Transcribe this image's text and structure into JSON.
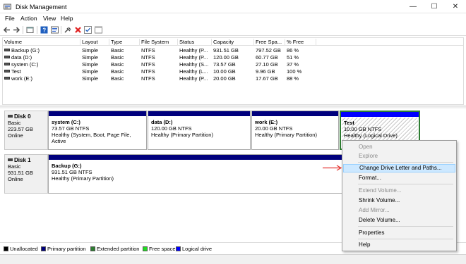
{
  "window": {
    "title": "Disk Management",
    "minimize": "—",
    "maximize": "☐",
    "close": "✕"
  },
  "menu": [
    "File",
    "Action",
    "View",
    "Help"
  ],
  "toolbar_icons": [
    "back-arrow-icon",
    "forward-arrow-icon",
    "properties-icon",
    "help-icon",
    "console-icon",
    "connect-icon",
    "delete-icon",
    "check-icon",
    "window-icon"
  ],
  "volume_list": {
    "columns": [
      "Volume",
      "Layout",
      "Type",
      "File System",
      "Status",
      "Capacity",
      "Free Spa...",
      "% Free"
    ],
    "rows": [
      [
        "Backup (G:)",
        "Simple",
        "Basic",
        "NTFS",
        "Healthy (P...",
        "931.51 GB",
        "797.52 GB",
        "86 %"
      ],
      [
        "data (D:)",
        "Simple",
        "Basic",
        "NTFS",
        "Healthy (P...",
        "120.00 GB",
        "60.77 GB",
        "51 %"
      ],
      [
        "system (C:)",
        "Simple",
        "Basic",
        "NTFS",
        "Healthy (S...",
        "73.57 GB",
        "27.10 GB",
        "37 %"
      ],
      [
        "Test",
        "Simple",
        "Basic",
        "NTFS",
        "Healthy (L...",
        "10.00 GB",
        "9.96 GB",
        "100 %"
      ],
      [
        "work (E:)",
        "Simple",
        "Basic",
        "NTFS",
        "Healthy (P...",
        "20.00 GB",
        "17.67 GB",
        "88 %"
      ]
    ]
  },
  "disks": [
    {
      "name": "Disk 0",
      "type": "Basic",
      "size": "223.57 GB",
      "status": "Online",
      "partitions": [
        {
          "name": "system  (C:)",
          "size": "73.57 GB NTFS",
          "health": "Healthy (System, Boot, Page File, Active"
        },
        {
          "name": "data  (D:)",
          "size": "120.00 GB NTFS",
          "health": "Healthy (Primary Partition)"
        },
        {
          "name": "work  (E:)",
          "size": "20.00 GB NTFS",
          "health": "Healthy (Primary Partition)"
        },
        {
          "name": "Test",
          "size": "10.00 GB NTFS",
          "health": "Healthy (Logical Drive)"
        }
      ]
    },
    {
      "name": "Disk 1",
      "type": "Basic",
      "size": "931.51 GB",
      "status": "Online",
      "partitions": [
        {
          "name": "Backup  (G:)",
          "size": "931.51 GB NTFS",
          "health": "Healthy (Primary Partition)"
        }
      ]
    }
  ],
  "legend": [
    {
      "label": "Unallocated",
      "color": "#000000"
    },
    {
      "label": "Primary partition",
      "color": "#00007d"
    },
    {
      "label": "Extended partition",
      "color": "#2e7d32"
    },
    {
      "label": "Free space",
      "color": "#22dd22"
    },
    {
      "label": "Logical drive",
      "color": "#0000ff"
    }
  ],
  "context_menu": {
    "items": [
      {
        "label": "Open",
        "enabled": false
      },
      {
        "label": "Explore",
        "enabled": false
      },
      {
        "label": "Change Drive Letter and Paths...",
        "enabled": true,
        "highlighted": true
      },
      {
        "label": "Format...",
        "enabled": true
      },
      {
        "label": "Extend Volume...",
        "enabled": false
      },
      {
        "label": "Shrink Volume...",
        "enabled": true
      },
      {
        "label": "Add Mirror...",
        "enabled": false
      },
      {
        "label": "Delete Volume...",
        "enabled": true
      },
      {
        "label": "Properties",
        "enabled": true
      },
      {
        "label": "Help",
        "enabled": true
      }
    ]
  },
  "colors": {
    "accent_arrow": "#e53935",
    "selected_border": "#2e7d32"
  }
}
